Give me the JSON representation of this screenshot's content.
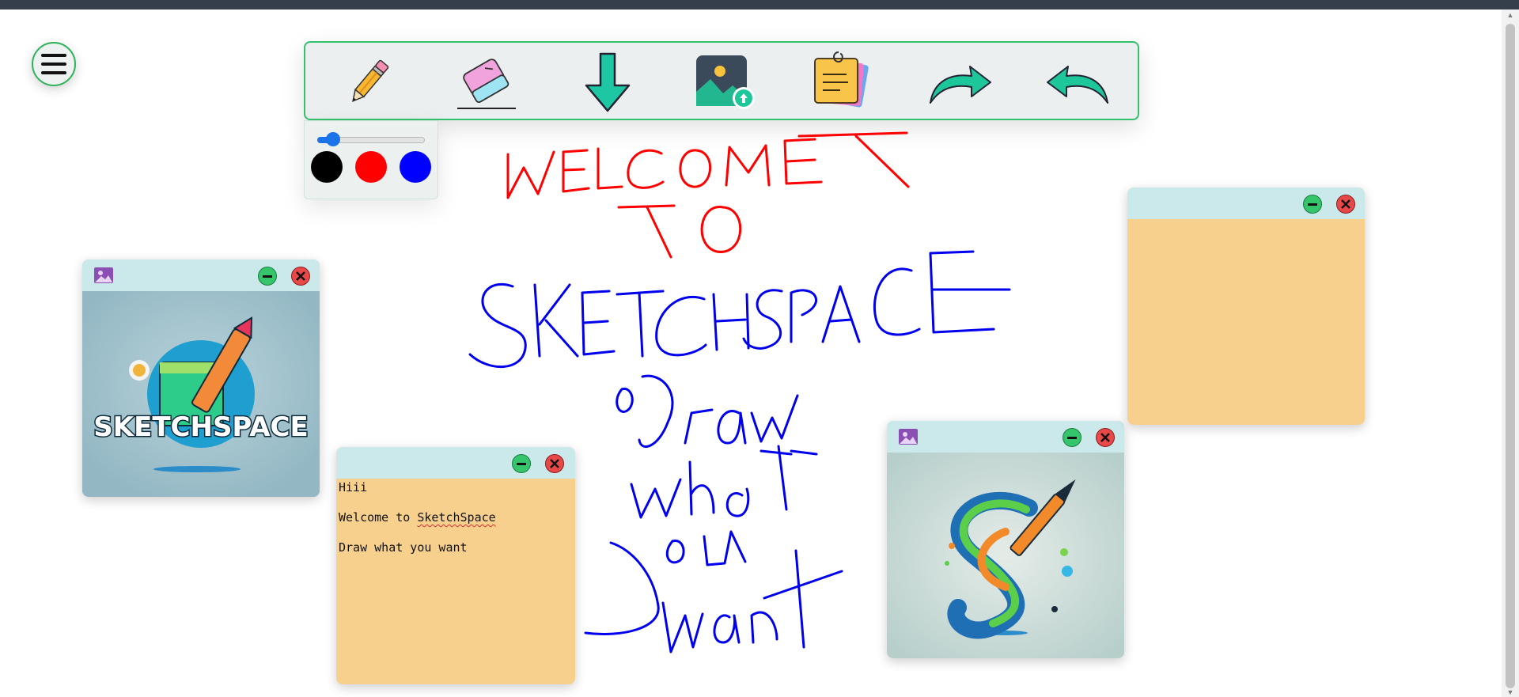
{
  "app": {
    "name": "SketchSpace"
  },
  "menu": {
    "icon": "hamburger-icon"
  },
  "toolbar": {
    "tools": [
      {
        "id": "pencil",
        "icon": "pencil-icon"
      },
      {
        "id": "eraser",
        "icon": "eraser-icon"
      },
      {
        "id": "download",
        "icon": "download-arrow-icon"
      },
      {
        "id": "image-upload",
        "icon": "image-upload-icon"
      },
      {
        "id": "sticky-note",
        "icon": "sticky-notes-icon"
      },
      {
        "id": "redo",
        "icon": "redo-arrow-icon"
      },
      {
        "id": "undo",
        "icon": "undo-arrow-icon"
      }
    ]
  },
  "pen_settings": {
    "stroke_size_fraction": 0.1,
    "colors": [
      "#000000",
      "#ff0000",
      "#0000ff"
    ]
  },
  "canvas": {
    "handwriting_red": "WELCOME TO",
    "handwriting_blue": "SKETCHSPACE Draw what you want"
  },
  "windows": {
    "image1": {
      "type": "image",
      "icon": "image-icon",
      "logo_text": "SKETCHSPACE"
    },
    "note1": {
      "type": "note",
      "lines": [
        "Hiii",
        "",
        "Welcome to ",
        "SketchSpace",
        "",
        "Draw what you want"
      ]
    },
    "image2": {
      "type": "image",
      "icon": "image-icon"
    },
    "note2": {
      "type": "note",
      "lines": []
    }
  },
  "colors": {
    "accent": "#34c16b",
    "note_bg": "#f7d08e",
    "window_header": "#cbe9ea",
    "minimize": "#35c56b",
    "close": "#e94848"
  }
}
